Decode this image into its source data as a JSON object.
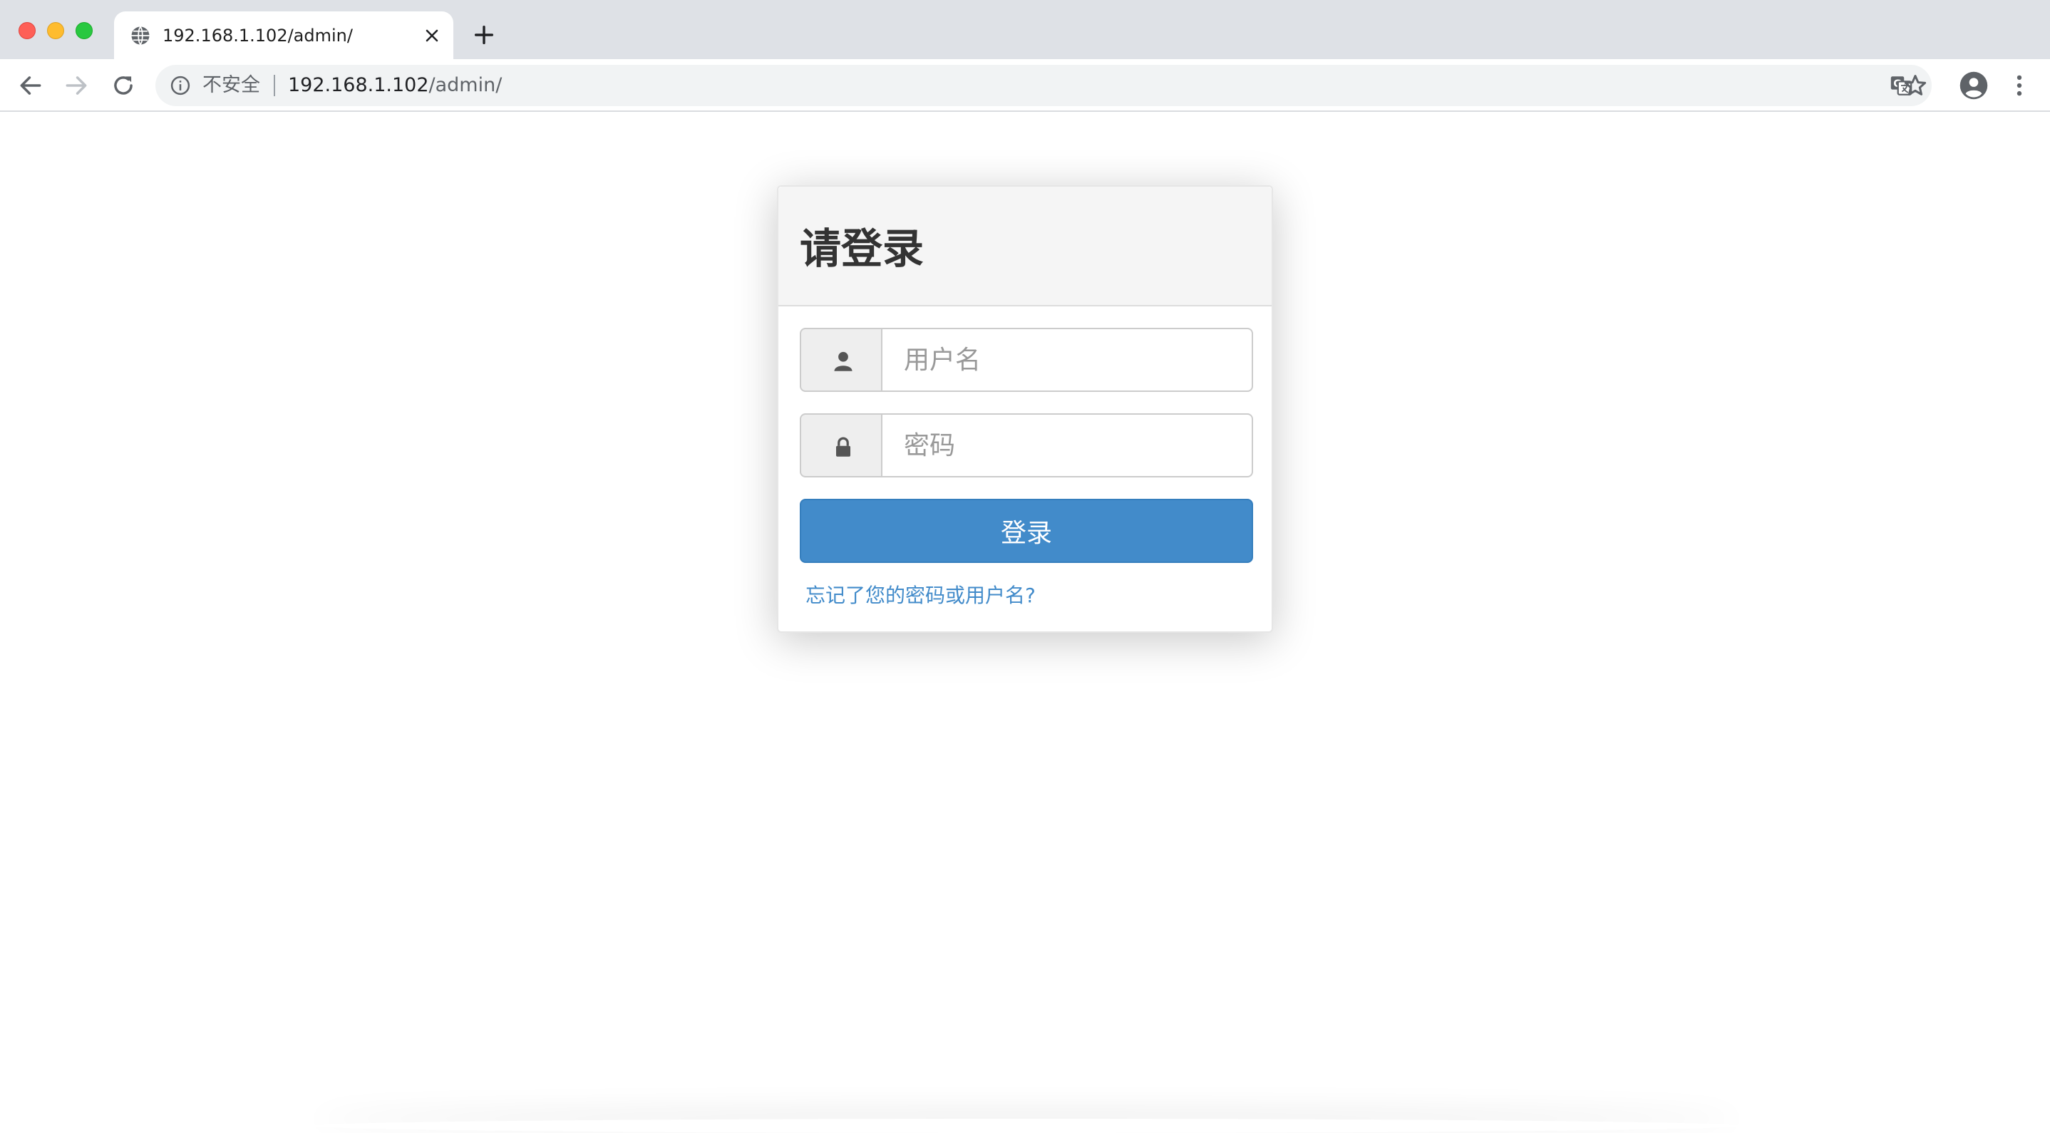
{
  "browser": {
    "tab": {
      "title": "192.168.1.102/admin/"
    },
    "omnibox": {
      "security_label": "不安全",
      "url_host": "192.168.1.102",
      "url_path": "/admin/"
    }
  },
  "login": {
    "title": "请登录",
    "username": {
      "placeholder": "用户名",
      "value": ""
    },
    "password": {
      "placeholder": "密码",
      "value": ""
    },
    "submit_label": "登录",
    "forgot_link": "忘记了您的密码或用户名?"
  },
  "colors": {
    "primary": "#428bca",
    "chrome_tabbar": "#dee1e6",
    "panel_heading": "#f5f5f5"
  },
  "icons": {
    "username_addon": "user-icon",
    "password_addon": "lock-icon"
  }
}
